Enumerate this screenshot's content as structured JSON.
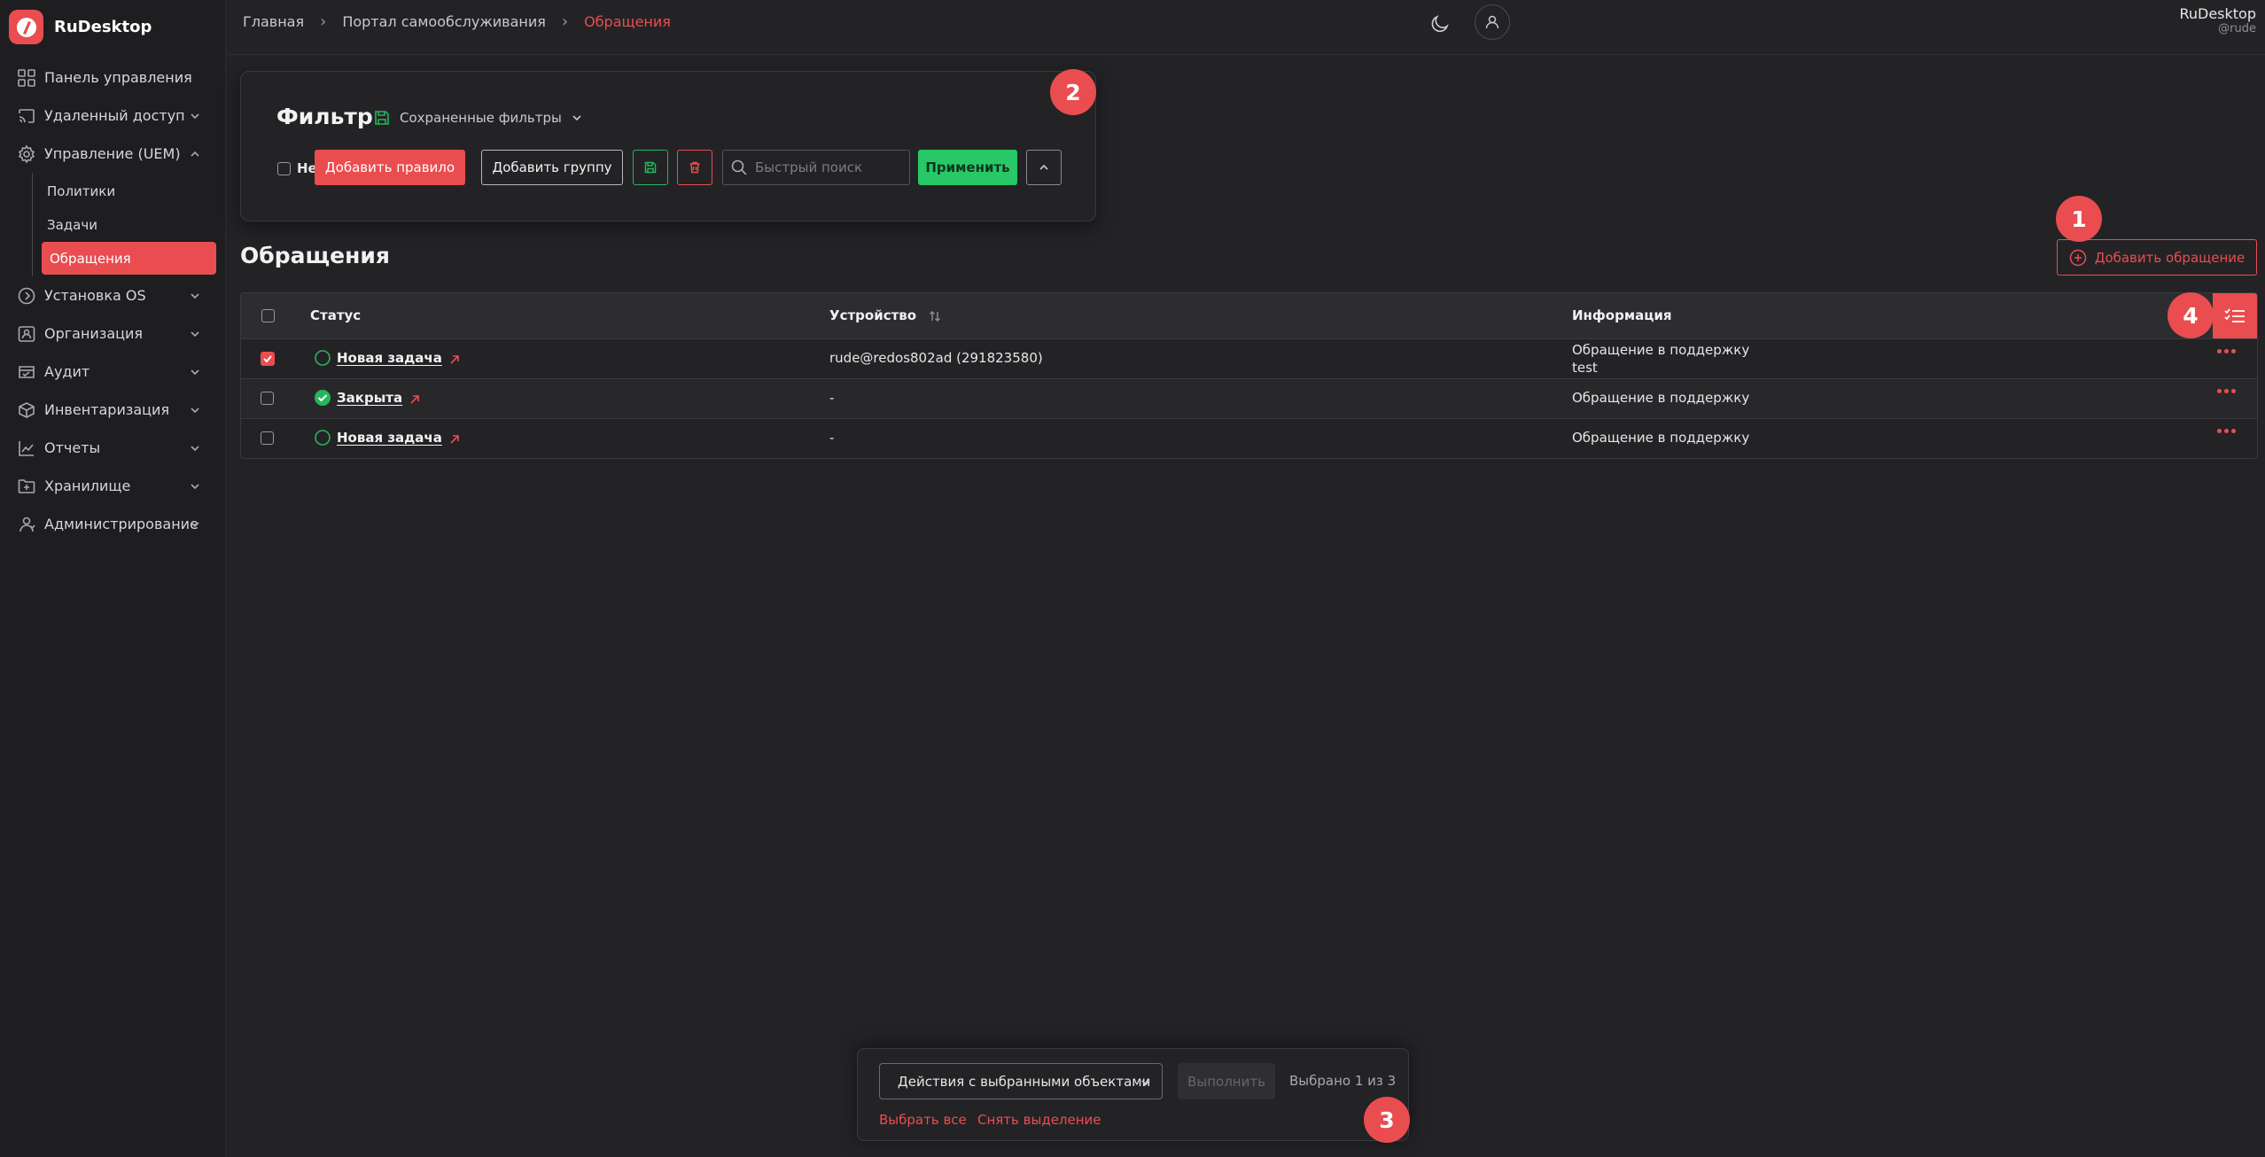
{
  "app": {
    "name": "RuDesktop"
  },
  "colors": {
    "accent": "#ea4d4f",
    "success": "#27c866",
    "background": "#232326",
    "sidebar": "#1e1e21"
  },
  "sidebar": {
    "items": [
      {
        "label": "Панель управления",
        "icon": "dashboard-icon"
      },
      {
        "label": "Удаленный доступ",
        "icon": "cast-icon"
      },
      {
        "label": "Управление (UEM)",
        "icon": "gear-icon"
      },
      {
        "label": "Установка OS",
        "icon": "disc-icon"
      },
      {
        "label": "Организация",
        "icon": "org-icon"
      },
      {
        "label": "Аудит",
        "icon": "audit-icon"
      },
      {
        "label": "Инвентаризация",
        "icon": "inventory-icon"
      },
      {
        "label": "Отчеты",
        "icon": "chart-icon"
      },
      {
        "label": "Хранилище",
        "icon": "folder-icon"
      },
      {
        "label": "Администрирование",
        "icon": "admin-icon"
      }
    ],
    "uem_sub": [
      "Политики",
      "Задачи",
      "Обращения"
    ]
  },
  "breadcrumb": [
    "Главная",
    "Портал самообслуживания",
    "Обращения"
  ],
  "user": {
    "name": "RuDesktop",
    "login": "@rude"
  },
  "filter": {
    "title": "Фильтр",
    "saved_filters": "Сохраненные фильтры",
    "not_label": "Не",
    "add_rule": "Добавить правило",
    "add_group": "Добавить группу",
    "search_placeholder": "Быстрый поиск",
    "apply": "Применить"
  },
  "page": {
    "title": "Обращения",
    "add_button": "Добавить обращение"
  },
  "table": {
    "headers": {
      "status": "Статус",
      "device": "Устройство",
      "info": "Информация"
    },
    "rows": [
      {
        "checked": true,
        "status": "Новая задача",
        "status_state": "open",
        "device": "rude@redos802ad (291823580)",
        "info": [
          "Обращение в поддержку",
          "test"
        ]
      },
      {
        "checked": false,
        "status": "Закрыта",
        "status_state": "closed",
        "device": "-",
        "info": [
          "Обращение в поддержку"
        ]
      },
      {
        "checked": false,
        "status": "Новая задача",
        "status_state": "open",
        "device": "-",
        "info": [
          "Обращение в поддержку"
        ]
      }
    ]
  },
  "bulk": {
    "actions_select": "Действия с выбранными объектами",
    "execute": "Выполнить",
    "selected": "Выбрано 1 из 3",
    "select_all": "Выбрать все",
    "clear_selection": "Снять выделение"
  },
  "markers": [
    "1",
    "2",
    "3",
    "4"
  ]
}
